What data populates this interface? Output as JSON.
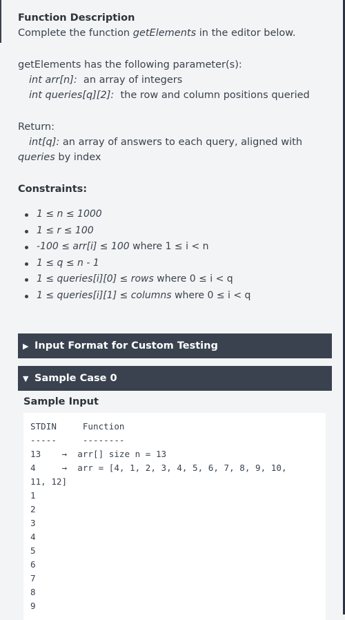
{
  "description": {
    "heading": "Function Description",
    "line1_prefix": "Complete the function ",
    "line1_fn": "getElements",
    "line1_suffix": " in the editor below."
  },
  "params": {
    "intro": "getElements has the following parameter(s):",
    "p1_type": "int arr[n]:",
    "p1_desc": "  an array of integers",
    "p2_type": "int queries[q][2]:",
    "p2_desc": "  the row and column positions queried"
  },
  "return": {
    "label": "Return:",
    "type": "int[q]:",
    "desc1": " an array of answers to each query, aligned with",
    "desc2_italic": "queries",
    "desc2_rest": " by index"
  },
  "constraints": {
    "heading": "Constraints:",
    "items": [
      {
        "italic": "1 ≤ n ≤ 1000",
        "rest": ""
      },
      {
        "italic": "1 ≤ r ≤ 100",
        "rest": ""
      },
      {
        "italic": "-100 ≤ arr[i] ≤ 100",
        "rest": " where 1 ≤ i < n"
      },
      {
        "italic": "1 ≤ q ≤ n - 1",
        "rest": ""
      },
      {
        "italic": "1 ≤ queries[i][0] ≤ rows",
        "rest": " where 0 ≤ i < q"
      },
      {
        "italic": "1 ≤ queries[i][1] ≤ columns",
        "rest": " where 0 ≤ i < q"
      }
    ]
  },
  "accordions": {
    "input_format": {
      "caret": "▶",
      "label": "Input Format for Custom Testing"
    },
    "sample_case": {
      "caret": "▼",
      "label": "Sample Case 0"
    }
  },
  "sample": {
    "label": "Sample Input",
    "lines": [
      "STDIN     Function",
      "-----     --------",
      "13    →  arr[] size n = 13",
      "4     →  arr = [4, 1, 2, 3, 4, 5, 6, 7, 8, 9, 10,",
      "11, 12]",
      "1",
      "2",
      "3",
      "4",
      "5",
      "6",
      "7",
      "8",
      "9"
    ]
  }
}
